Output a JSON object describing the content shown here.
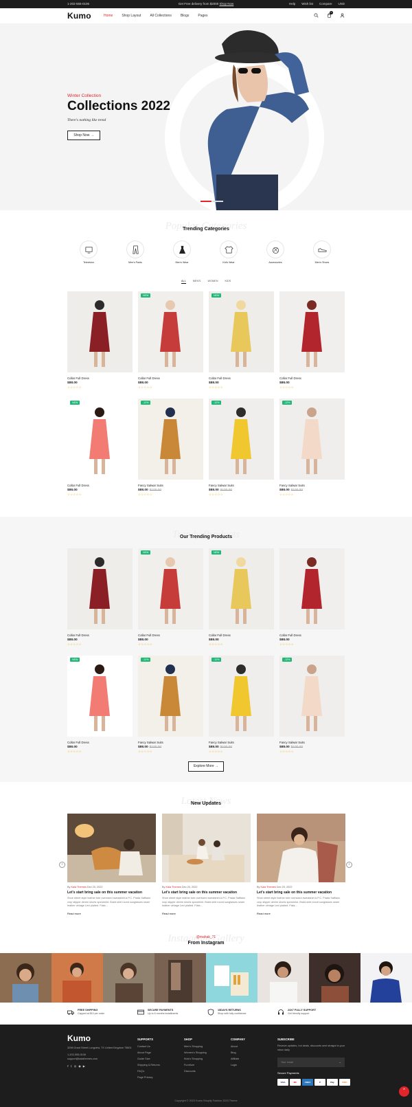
{
  "topbar": {
    "phone": "1-202-555-0106",
    "promo": "Get Free delivery from $2000",
    "promo_link": "Shop Now",
    "links": [
      "Help",
      "Wish list",
      "Compare",
      "USD"
    ]
  },
  "header": {
    "logo": "Kumo",
    "nav": [
      "Home",
      "Shop Layout",
      "All Collections",
      "Blogs",
      "Pages"
    ],
    "cart_count": "0"
  },
  "hero": {
    "eyebrow": "Winter Collection",
    "title": "Collections 2022",
    "subtitle": "There's nothing like trend",
    "button": "Shop Now →"
  },
  "categories": {
    "ghost": "Popular Categories",
    "title": "Trending Categories",
    "items": [
      "Television",
      "Men's Pants",
      "Men's Wear",
      "Kid's Wear",
      "Accessories",
      "Men's Shoes"
    ],
    "icons": [
      "tv-icon",
      "pants-icon",
      "dress-icon",
      "tshirt-icon",
      "accessories-icon",
      "shoe-icon"
    ]
  },
  "filter_tabs": [
    "ALL",
    "MEN'S",
    "WOMEN",
    "KIDS"
  ],
  "products": [
    {
      "name": "Collar Full Dress",
      "price": "$88.00",
      "old": "",
      "badge": ""
    },
    {
      "name": "Collar Full Dress",
      "price": "$88.00",
      "old": "",
      "badge": "NEW"
    },
    {
      "name": "Collar Full Dress",
      "price": "$88.00",
      "old": "",
      "badge": "NEW"
    },
    {
      "name": "Collar Full Dress",
      "price": "$88.00",
      "old": "",
      "badge": ""
    },
    {
      "name": "Collar Full Dress",
      "price": "$88.00",
      "old": "",
      "badge": "NEW"
    },
    {
      "name": "Fancy Salwar Suits",
      "price": "$88.00",
      "old": "$100.00",
      "badge": "-12%"
    },
    {
      "name": "Fancy Salwar Suits",
      "price": "$88.00",
      "old": "$100.00",
      "badge": "-12%"
    },
    {
      "name": "Fancy Salwar Suits",
      "price": "$88.00",
      "old": "$100.00",
      "badge": "-12%"
    }
  ],
  "stars": "☆☆☆☆☆",
  "trending": {
    "ghost": "Trendy Products",
    "title": "Our Trending Products",
    "button": "Explore More →"
  },
  "news": {
    "ghost": "Latest News",
    "title": "New Updates",
    "posts": [
      {
        "author": "Kala Themes",
        "date": "Dec 20, 2022",
        "title": "Let's start bring sale on this summer vacation",
        "excerpt": "Shoe street style leather tote oversized sweatshirt A.P.C. Prada Saffiano crop slipper denim shorts spearmint. Braid skirt round sunglasses seam leather vintage Levi plaited. Flats...",
        "more": "Read more"
      },
      {
        "author": "Kala Themes",
        "date": "Dec 20, 2022",
        "title": "Let's start bring sale on this summer vacation",
        "excerpt": "Shoe street style leather tote oversized sweatshirt A.P.C. Prada Saffiano crop slipper denim shorts spearmint. Braid skirt round sunglasses seam leather vintage Levi plaited. Flats...",
        "more": "Read more"
      },
      {
        "author": "Kala Themes",
        "date": "Dec 20, 2022",
        "title": "Let's start bring sale on this summer vacation",
        "excerpt": "Shoe street style leather tote oversized sweatshirt A.P.C. Prada Saffiano crop slipper denim shorts spearmint. Braid skirt round sunglasses seam leather vintage Levi plaited. Flats...",
        "more": "Read more"
      }
    ],
    "by": "By"
  },
  "instagram": {
    "ghost": "Instagram Gallery",
    "handle": "@mahak_71",
    "title": "From Instagram"
  },
  "features": [
    {
      "title": "FREE SHIPPING",
      "desc": "Capped at $10 per order"
    },
    {
      "title": "SECURE PAYMENTS",
      "desc": "Up to 6 months installments"
    },
    {
      "title": "15DAYS RETURNS",
      "desc": "Shop with fully confidence"
    },
    {
      "title": "24X7 FULLY SUPPORT",
      "desc": "Get friendly support"
    }
  ],
  "footer": {
    "logo": "Kumo",
    "address": "3298 Grant Street Longview, TX United Kingdom 75601",
    "phone": "1-202-555-0106",
    "email": "support@kalathemes.com",
    "supports": {
      "title": "SUPPORTS",
      "links": [
        "Contact Us",
        "About Page",
        "Guide Size",
        "Shipping & Returns",
        "FAQ's",
        "Page Privacy"
      ]
    },
    "shop": {
      "title": "SHOP",
      "links": [
        "Men's Shopping",
        "Women's Shopping",
        "Kids's Shopping",
        "Furniture",
        "Discounts"
      ]
    },
    "company": {
      "title": "COMPANY",
      "links": [
        "About",
        "Blog",
        "Affiliate",
        "Login"
      ]
    },
    "subscribe": {
      "title": "SUBSCRIBE",
      "text": "Receive updates, hot deals, discounts sent straignt in your inbox daily",
      "placeholder": "Your email",
      "payments_title": "Secure Payments",
      "payments": [
        "VISA",
        "MC",
        "AMEX",
        "P",
        "Pay",
        "DISC"
      ]
    },
    "copyright": "Copyright © 2023 Kumo Shopify Fashion 2023 Theme"
  },
  "colors": {
    "accent": "#e0262b",
    "badge_green": "#1fb877",
    "footer_bg": "#1d1d1d"
  }
}
